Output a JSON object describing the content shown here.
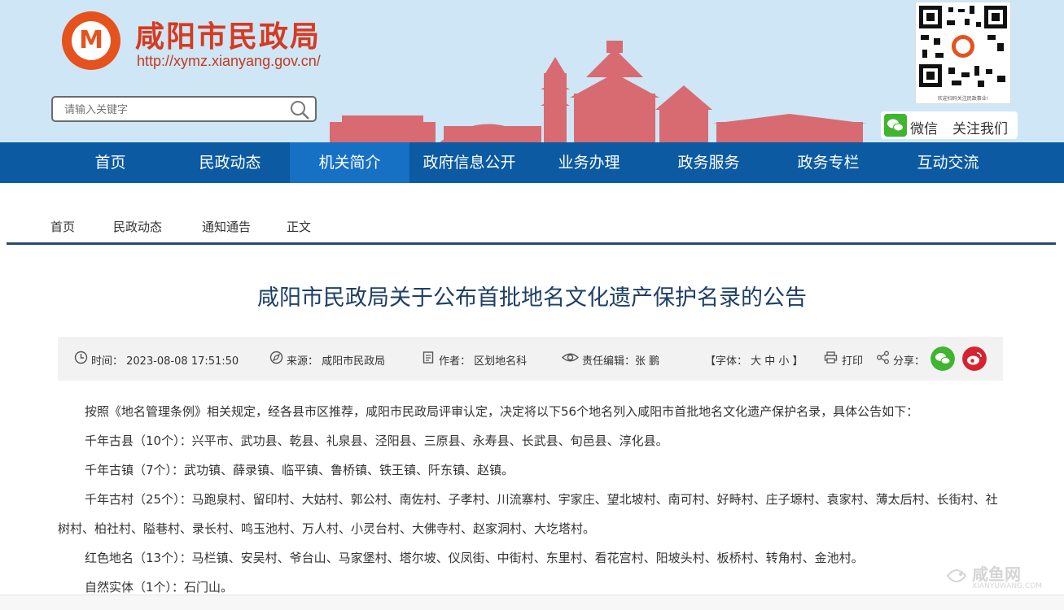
{
  "header": {
    "logo_char": "M",
    "title": "咸阳市民政局",
    "url": "http://xymz.xianyang.gov.cn/",
    "search": {
      "placeholder": "请输入关键字"
    },
    "qr_caption": "欢迎扫码关注民政事业!",
    "follow": {
      "wechat": "微信",
      "label": "关注我们"
    }
  },
  "nav": {
    "items": [
      "首页",
      "民政动态",
      "机关简介",
      "政府信息公开",
      "业务办理",
      "政务服务",
      "政务专栏",
      "互动交流"
    ],
    "active_index": 2
  },
  "breadcrumb": [
    "首页",
    "民政动态",
    "通知通告",
    "正文"
  ],
  "article": {
    "title": "咸阳市民政局关于公布首批地名文化遗产保护名录的公告",
    "meta": {
      "time": "时间： 2023-08-08 17:51:50",
      "source": "来源： 咸阳市民政局",
      "author": "作者： 区划地名科",
      "editor": "责任编辑：张 鹏",
      "font": "【字体： 大 中 小 】",
      "print": "打印",
      "share": "分享："
    },
    "paragraphs": [
      "按照《地名管理条例》相关规定，经各县市区推荐，咸阳市民政局评审认定，决定将以下56个地名列入咸阳市首批地名文化遗产保护名录，具体公告如下：",
      "千年古县（10个）：兴平市、武功县、乾县、礼泉县、泾阳县、三原县、永寿县、长武县、旬邑县、淳化县。",
      "千年古镇（7个）：武功镇、薛录镇、临平镇、鲁桥镇、铁王镇、阡东镇、赵镇。",
      "千年古村（25个）：马跑泉村、留印村、大姑村、郭公村、南佐村、子孝村、川流寨村、宇家庄、望北坡村、南可村、好畤村、庄子塬村、袁家村、薄太后村、长街村、社树村、柏社村、隘巷村、录长村、鸣玉池村、万人村、小灵台村、大佛寺村、赵家洞村、大圪塔村。",
      "红色地名（13个）：马栏镇、安吴村、爷台山、马家堡村、塔尔坡、仪凤街、中街村、东里村、看花宫村、阳坡头村、板桥村、转角村、金池村。",
      "自然实体（1个）：石门山。"
    ]
  },
  "watermark": {
    "text": "咸鱼网",
    "sub": "XIANYUWANG.COM"
  },
  "colors": {
    "nav": "#0b5aa2",
    "nav_active": "#1670c4",
    "title": "#1e3f66",
    "brand": "#d63a1f"
  }
}
